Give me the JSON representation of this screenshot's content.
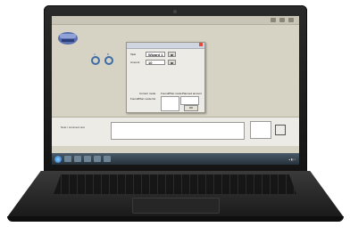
{
  "dialog": {
    "row1_label": "Task",
    "row1_value": "Wizard 1",
    "row2_label": "Amount",
    "row2_value": "10",
    "col1_header": "Current mode",
    "col2_header": "Found/Plan mode",
    "col3_header": "Planned amount",
    "subheader": "Found/Plan mode list",
    "button_label": "OK"
  },
  "gears": {
    "left_label": "A",
    "right_label": "B"
  },
  "bottom_panel": {
    "label": "Note / comment text"
  },
  "icons": {
    "logo": "app-logo-icon",
    "start": "windows-start-icon"
  }
}
